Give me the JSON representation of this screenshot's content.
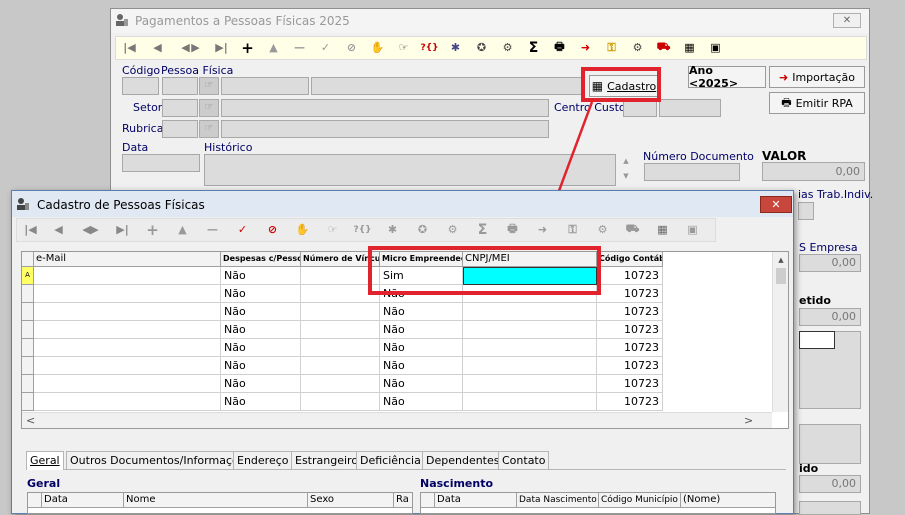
{
  "bg_window": {
    "title": "Pagamentos a Pessoas Físicas 2025",
    "close_glyph": "✕",
    "fields": {
      "codigo": "Código",
      "pessoa_fisica": "Pessoa Física",
      "setor": "Setor",
      "rubrica": "Rubrica",
      "data": "Data",
      "historico": "Histórico",
      "numero_documento": "Número Documento",
      "centro_custos": "Centro Custos",
      "valor": "VALOR",
      "valor_amount": "0,00",
      "dias_trab": "ias Trab.Indiv.",
      "s_empresa": "S Empresa",
      "s_empresa_amount": "0,00",
      "retido": "etido",
      "retido_amount": "0,00",
      "ido": "ido",
      "ido_amount": "0,00"
    },
    "buttons": {
      "cadastro": "Cadastro",
      "ano": "Ano <2025>",
      "importacao": "Importação",
      "emitir_rpa": "Emitir RPA"
    }
  },
  "fg_window": {
    "title": "Cadastro de Pessoas Físicas",
    "close_glyph": "✕",
    "grid": {
      "columns": [
        "e-Mail",
        "Despesas c/Pessoal",
        "Número de Vínculos",
        "Micro Empreendedor",
        "CNPJ/MEI",
        "Código Contábil"
      ],
      "rows": [
        {
          "indicator": "A",
          "email": "",
          "despesas": "Não",
          "vinculos": "",
          "micro": "Sim",
          "cnpj": "",
          "codigo": "10723"
        },
        {
          "indicator": "",
          "email": "",
          "despesas": "Não",
          "vinculos": "",
          "micro": "Não",
          "cnpj": "",
          "codigo": "10723"
        },
        {
          "indicator": "",
          "email": "",
          "despesas": "Não",
          "vinculos": "",
          "micro": "Não",
          "cnpj": "",
          "codigo": "10723"
        },
        {
          "indicator": "",
          "email": "",
          "despesas": "Não",
          "vinculos": "",
          "micro": "Não",
          "cnpj": "",
          "codigo": "10723"
        },
        {
          "indicator": "",
          "email": "",
          "despesas": "Não",
          "vinculos": "",
          "micro": "Não",
          "cnpj": "",
          "codigo": "10723"
        },
        {
          "indicator": "",
          "email": "",
          "despesas": "Não",
          "vinculos": "",
          "micro": "Não",
          "cnpj": "",
          "codigo": "10723"
        },
        {
          "indicator": "",
          "email": "",
          "despesas": "Não",
          "vinculos": "",
          "micro": "Não",
          "cnpj": "",
          "codigo": "10723"
        },
        {
          "indicator": "",
          "email": "",
          "despesas": "Não",
          "vinculos": "",
          "micro": "Não",
          "cnpj": "",
          "codigo": "10723"
        }
      ]
    },
    "tabs": [
      "Geral",
      "Outros Documentos/Informações",
      "Endereço",
      "Estrangeiro",
      "Deficiência",
      "Dependentes",
      "Contato"
    ],
    "sections": {
      "geral": "Geral",
      "nascimento": "Nascimento"
    },
    "geral_columns": [
      "Data",
      "Nome",
      "Sexo",
      "Ra"
    ],
    "nascimento_columns": [
      "Data",
      "Data Nascimento",
      "Código Município",
      "(Nome)"
    ]
  },
  "colors": {
    "highlight": "#e0232d",
    "cyan_cell": "#00ffff",
    "title_bar_fg": "#dfe8f3",
    "title_bar_bg": "#f4f4f4"
  }
}
